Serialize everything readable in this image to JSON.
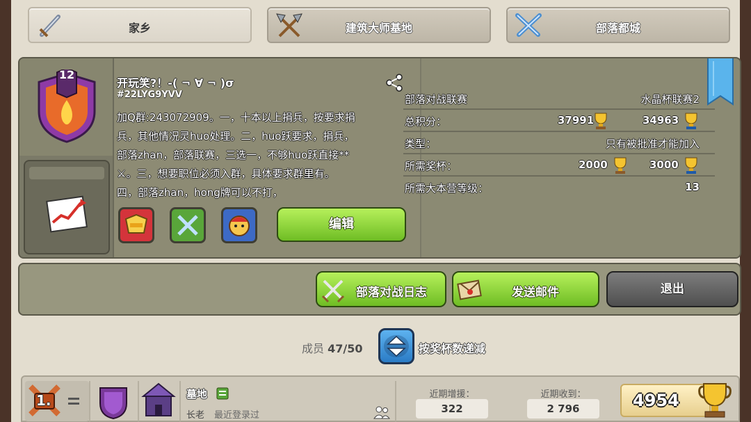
{
  "tabs": [
    {
      "label": "家乡",
      "icon": "sword-icon",
      "active": true
    },
    {
      "label": "建筑大师基地",
      "icon": "crossed-axes-icon",
      "active": false
    },
    {
      "label": "部落都城",
      "icon": "crossed-swords-icon",
      "active": false
    }
  ],
  "clan": {
    "level": "12",
    "name": "开玩笑?！-( ¬ ∀ ¬ )σ",
    "tag": "#22LYG9YVV",
    "description_lines": [
      "加Q群:243072909。一，十本以上捐兵，按要求捐",
      "兵，其他情况灵huo处理。二，huo跃要求，捐兵，",
      "部落zhan，部落联赛，三选一，不够huo跃直接**",
      "⚔。三，想要职位必须入群，具体要求群里有。",
      "四，部落zhan，hong牌可以不打，"
    ],
    "edit_label": "编辑"
  },
  "stats": {
    "war_league_label": "部落对战联赛",
    "war_league_value": "水晶杯联赛2",
    "total_points_label": "总积分：",
    "total_points_home": "37991",
    "total_points_builder": "34963",
    "type_label": "类型：",
    "type_value": "只有被批准才能加入",
    "required_trophies_label": "所需奖杯：",
    "required_trophies_home": "2000",
    "required_trophies_builder": "3000",
    "required_th_label": "所需大本营等级：",
    "required_th_value": "13"
  },
  "actions": {
    "war_log": "部落对战日志",
    "send_mail": "发送邮件",
    "leave": "退出"
  },
  "members": {
    "count_label": "成员",
    "count_value": "47/50",
    "sort_label": "按奖杯数递减"
  },
  "member_row": {
    "rank": "1.",
    "name": "墓地",
    "role": "长老",
    "last_login": "最近登录过",
    "donated_label": "近期增援：",
    "donated_value": "322",
    "received_label": "近期收到：",
    "received_value": "2 796",
    "trophies": "4954"
  }
}
